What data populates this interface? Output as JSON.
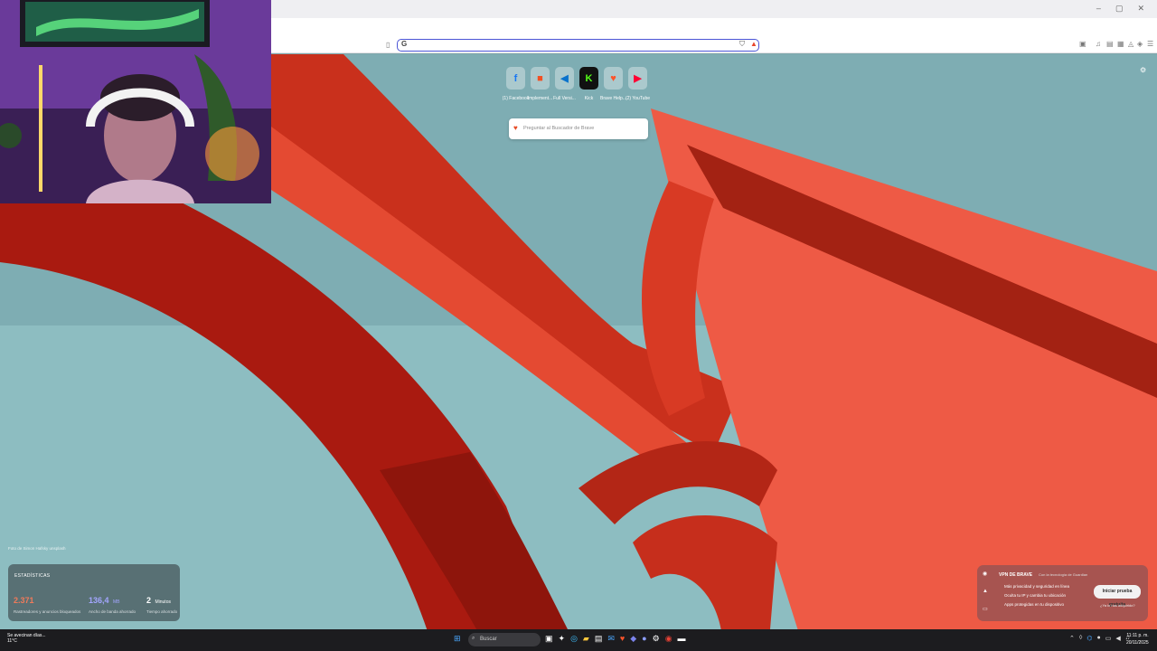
{
  "browser": {
    "window_controls": [
      "–",
      "▢",
      "✕"
    ],
    "address_bar": {
      "value": "G",
      "placeholder": ""
    }
  },
  "new_tab": {
    "top_sites": [
      {
        "label": "(1) Facebook",
        "icon": "facebook-icon",
        "glyph": "f",
        "color": "#1877f2"
      },
      {
        "label": "Implement...",
        "icon": "microsoft-icon",
        "glyph": "■",
        "color": "#f25022"
      },
      {
        "label": "Full Versi...",
        "icon": "vscode-icon",
        "glyph": "◀",
        "color": "#0a72cc"
      },
      {
        "label": "Kick",
        "icon": "kick-icon",
        "glyph": "K",
        "color": "#53fc18"
      },
      {
        "label": "Brave Help...",
        "icon": "brave-icon",
        "glyph": "♥",
        "color": "#fb542b"
      },
      {
        "label": "(2) YouTube",
        "icon": "youtube-icon",
        "glyph": "▶",
        "color": "#ff0033"
      }
    ],
    "search_placeholder": "Preguntar al Buscador de Brave",
    "photo_credit": "Foto de Simon Hafsky unsplash"
  },
  "stats": {
    "title": "ESTADÍSTICAS",
    "items": [
      {
        "value": "2.371",
        "unit": "",
        "desc": "Rastreadores y anuncios bloqueados",
        "color": "#f07a5a"
      },
      {
        "value": "136,4",
        "unit": "MB",
        "desc": "Ancho de banda ahorrado",
        "color": "#a3a6ff"
      },
      {
        "value": "2",
        "unit": "Minutos",
        "desc": "Tiempo ahorrado",
        "color": "#ffffff"
      }
    ]
  },
  "vpn_card": {
    "title": "VPN DE BRAVE",
    "subtitle": "Con la tecnología de Guardian",
    "bullets": [
      "Más privacidad y seguridad en línea",
      "Oculta tu IP y cambia tu ubicación",
      "Apps protegidas en tu dispositivo"
    ],
    "cta": "Iniciar prueba gratuita",
    "link": "¿Ya lo has adquirido?"
  },
  "taskbar": {
    "weather_title": "Se avecinan días...",
    "weather_temp": "11°C",
    "search_placeholder": "Buscar",
    "time": "11:11 p. m.",
    "date": "20/11/2025"
  }
}
